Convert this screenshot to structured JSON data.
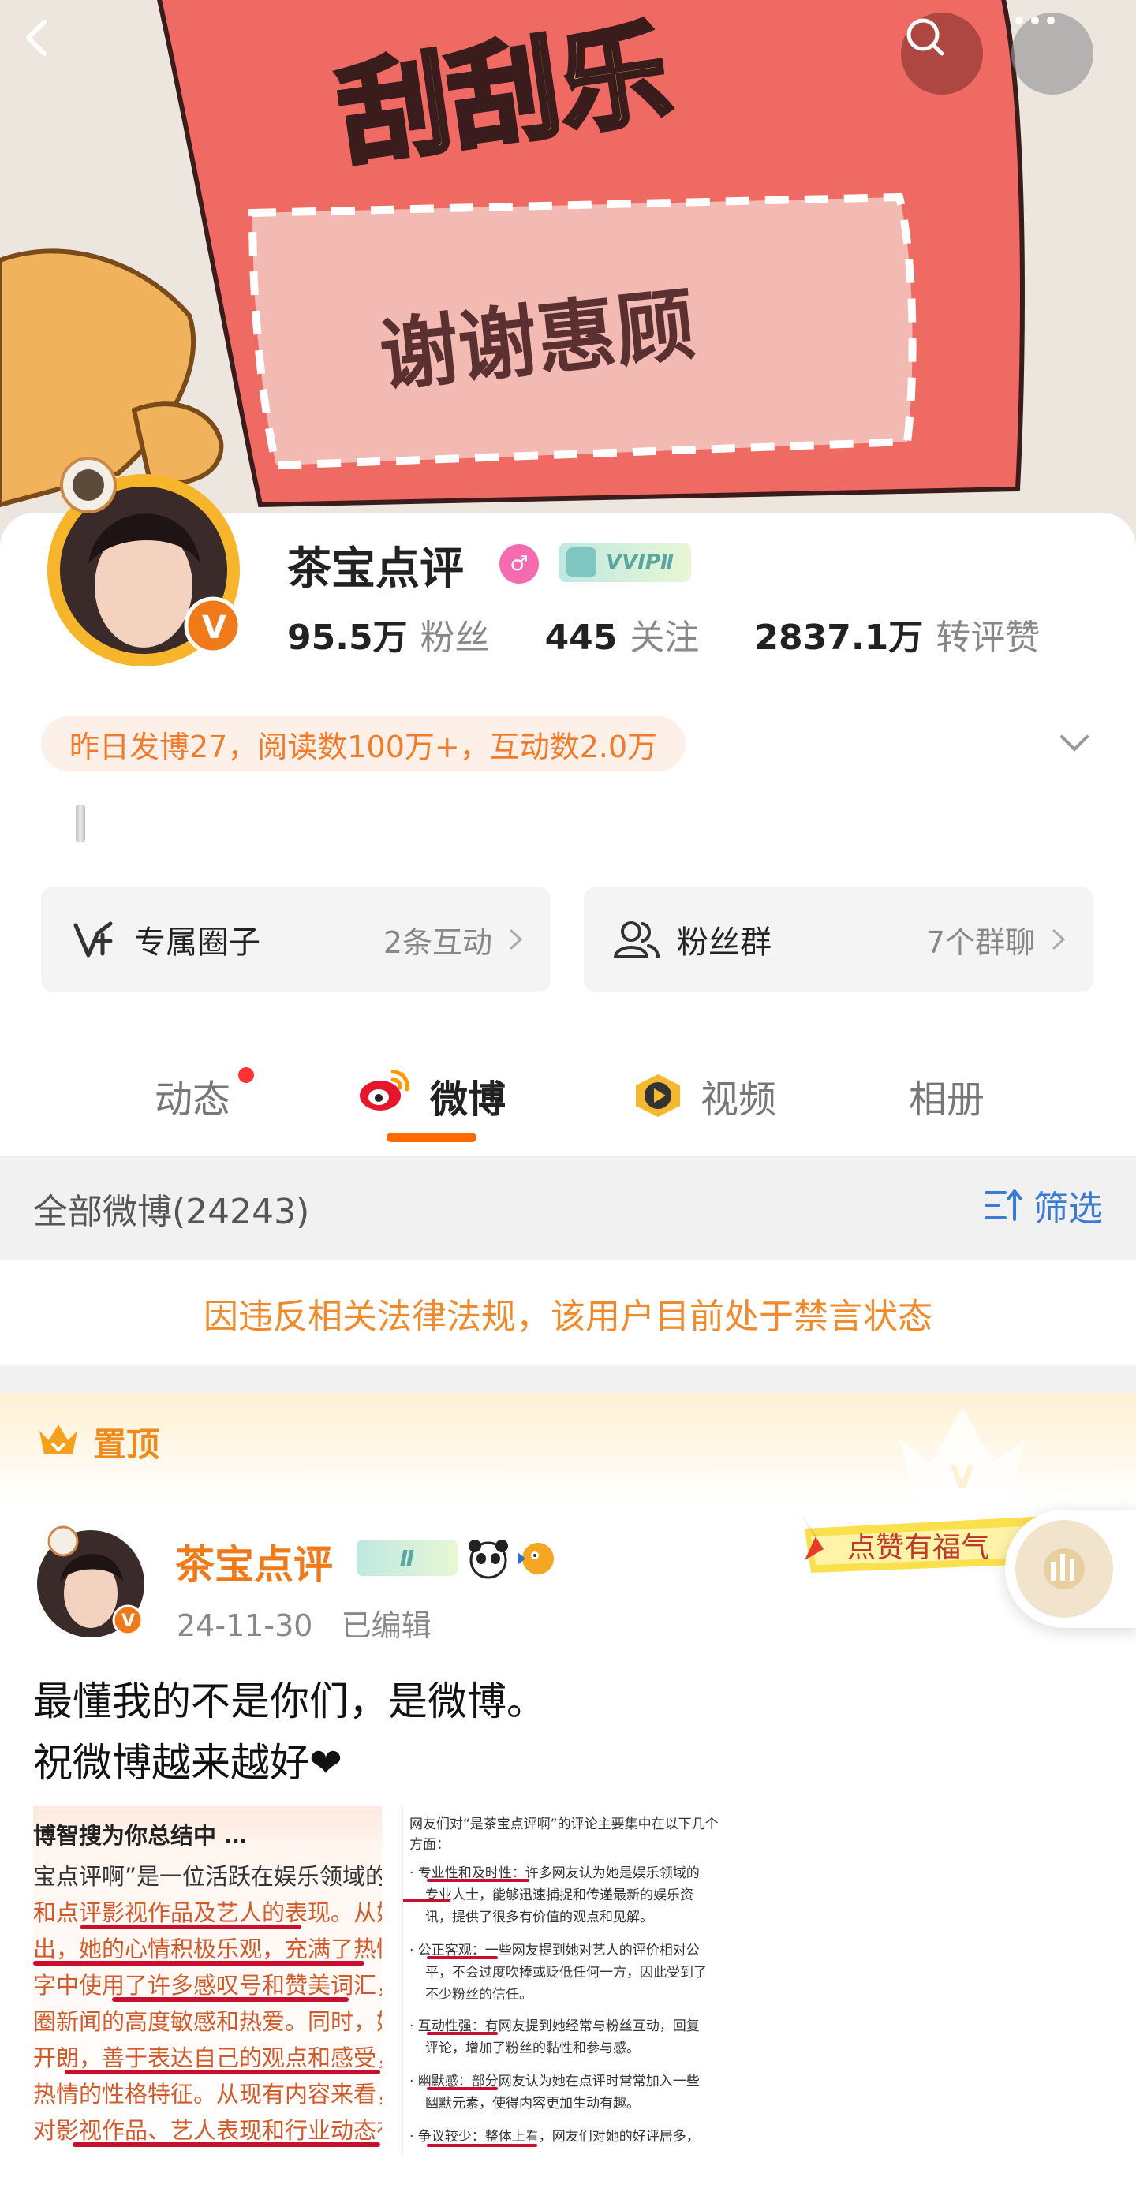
{
  "banner": {
    "title": "刮刮乐",
    "text": "谢谢惠顾"
  },
  "nav": {
    "back_icon": "back-icon",
    "search_icon": "search-icon",
    "more_icon": "more-icon"
  },
  "profile": {
    "name": "茶宝点评",
    "vip_label": "VVIPⅡ",
    "followers_count": "95.5万",
    "followers_label": "粉丝",
    "following_count": "445",
    "following_label": "关注",
    "likes_count": "2837.1万",
    "likes_label": "转评赞",
    "summary": "昨日发博27，阅读数100万+，互动数2.0万"
  },
  "cards": {
    "group_title": "专属圈子",
    "group_sub": "2条互动",
    "fans_title": "粉丝群",
    "fans_sub": "7个群聊"
  },
  "tabs": {
    "dongtai": "动态",
    "weibo": "微博",
    "video": "视频",
    "album": "相册"
  },
  "filter": {
    "all_weibo": "全部微博(24243)",
    "filter_label": "筛选"
  },
  "banned_notice": "因违反相关法律法规，该用户目前处于禁言状态",
  "pinned": {
    "label": "置顶",
    "author": "茶宝点评",
    "badge": "Ⅱ",
    "date": "24-11-30",
    "edited": "已编辑",
    "like_banner": "点赞有福气",
    "text_line1": "最懂我的不是你们，是微博。",
    "text_line2": "祝微博越来越好❤"
  },
  "image1": {
    "lines": [
      "博智搜为你总结中 …",
      "宝点评啊”是一位活跃在娱乐领域的博主,",
      "和点评影视作品及艺人的表现。从她的发文",
      "出，她的心情积极乐观，充满了热情和兴奋",
      "字中使用了许多感叹号和赞美词汇，显示",
      "圈新闻的高度敏感和热爱。同时，她的话语",
      "开朗，善于表达自己的观点和感受，体现出",
      "热情的性格特征。从现有内容来看，“是茶",
      "对影视作品、艺人表现和行业动态有着浓"
    ]
  },
  "image2": {
    "lines": [
      "网友们对“是茶宝点评啊”的评论主要集中在以下几个",
      "方面：",
      "· 专业性和及时性：许多网友认为她是娱乐领域的",
      "专业人士，能够迅速捕捉和传递最新的娱乐资",
      "讯，提供了很多有价值的观点和见解。",
      "· 公正客观：一些网友提到她对艺人的评价相对公",
      "平，不会过度吹捧或贬低任何一方，因此受到了",
      "不少粉丝的信任。",
      "· 互动性强：有网友提到她经常与粉丝互动，回复",
      "评论，增加了粉丝的黏性和参与感。",
      "· 幽默感：部分网友认为她在点评时常常加入一些",
      "幽默元素，使得内容更加生动有趣。",
      "· 争议较少：整体上看，网友们对她的好评居多，"
    ]
  },
  "colors": {
    "accent_orange": "#ff6a00",
    "banned_text": "#f08a2a",
    "filter_blue": "#3a7bd5",
    "summary_text": "#f07b2a"
  }
}
